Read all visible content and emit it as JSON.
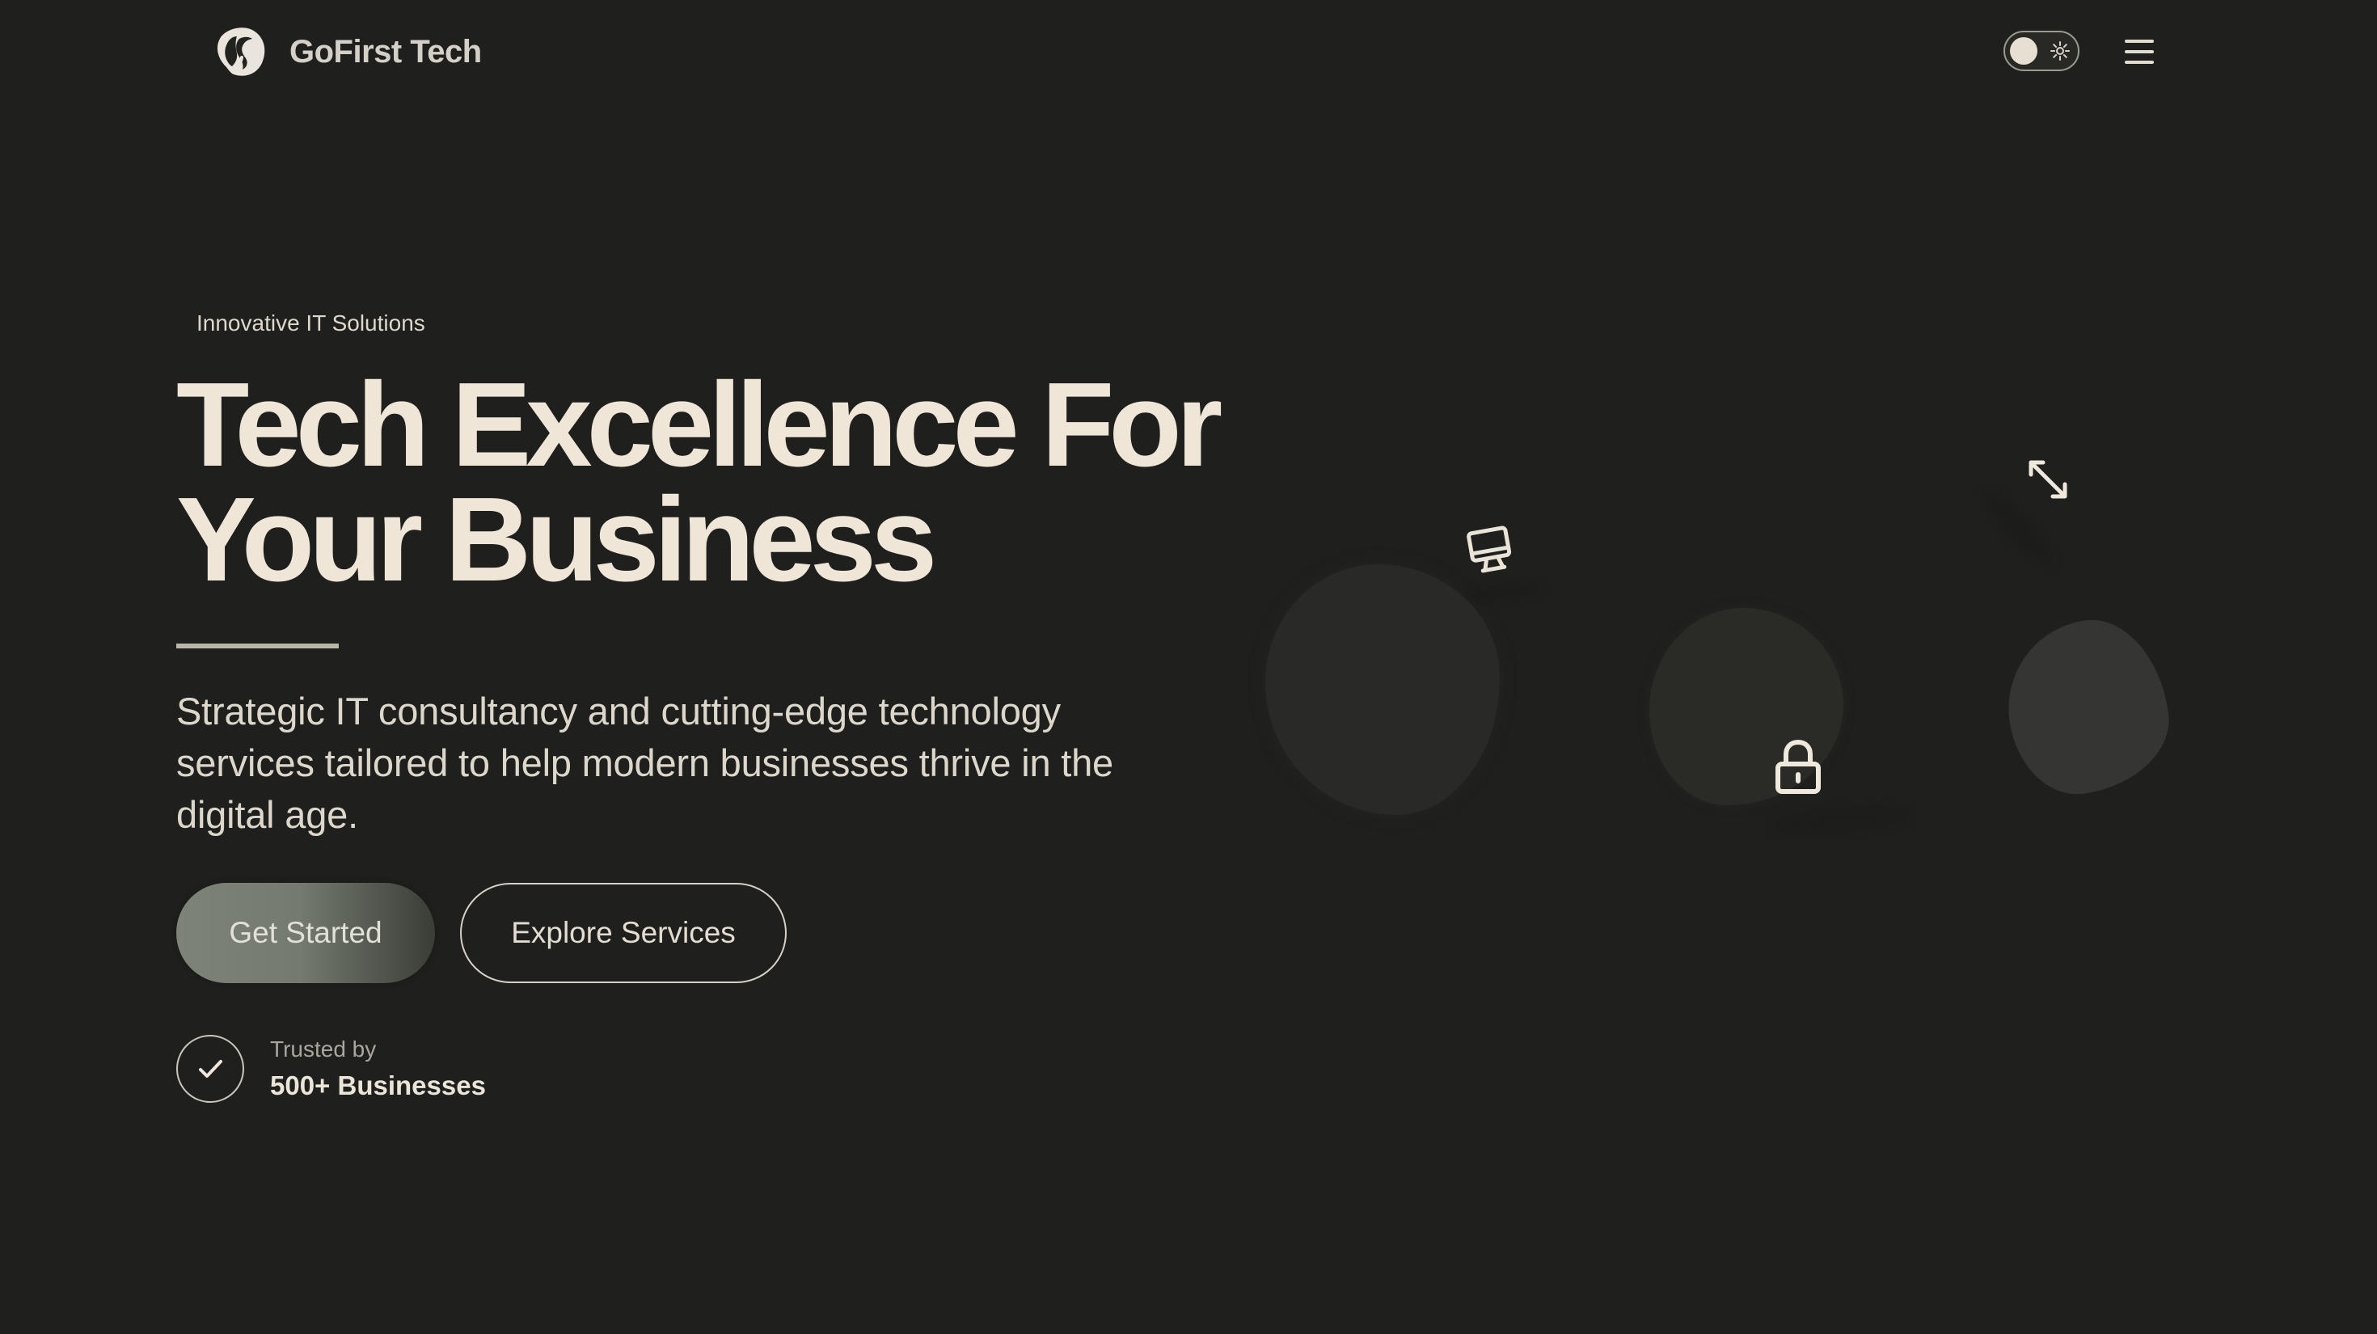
{
  "brand": {
    "name": "GoFirst Tech",
    "logo_icon": "logo-icon"
  },
  "header": {
    "theme_toggle_icon": "sun-icon",
    "menu_icon": "hamburger-menu-icon"
  },
  "hero": {
    "eyebrow": "Innovative IT Solutions",
    "headline_line_1": "Tech Excellence For",
    "headline_line_2": "Your Business",
    "description": "Strategic IT consultancy and cutting-edge technology services tailored to help modern businesses thrive in the digital age.",
    "primary_cta": "Get Started",
    "secondary_cta": "Explore Services",
    "trust_label": "Trusted by",
    "trust_count": "500+ Businesses"
  },
  "illustration": {
    "icons": [
      "monitor-icon",
      "lock-icon",
      "diagonal-arrows-icon"
    ]
  },
  "colors": {
    "background": "#1f201e",
    "text": "#efe6d8",
    "muted_text": "#aaa69d",
    "primary_button_start": "#7e8378",
    "primary_button_end": "#3a3d35",
    "blob": "#292a27"
  }
}
